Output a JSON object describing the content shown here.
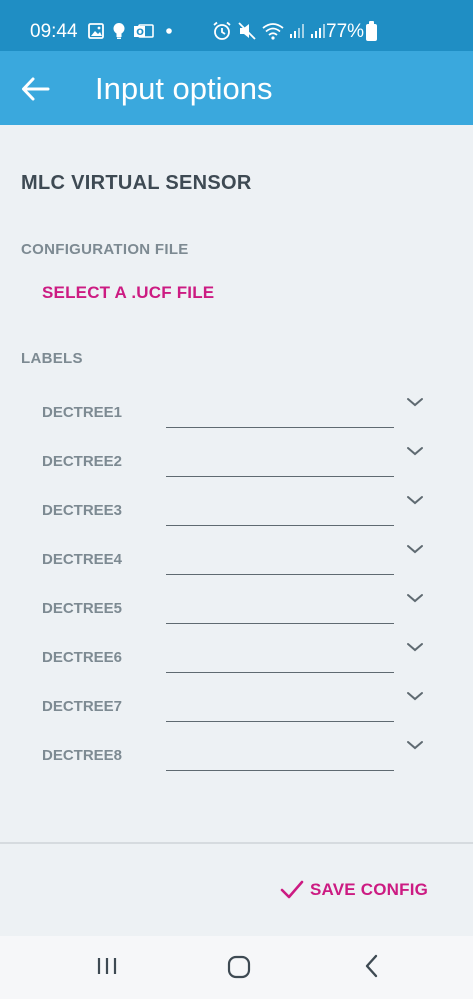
{
  "status_bar": {
    "time": "09:44",
    "battery": "77%",
    "icons": [
      "gallery-icon",
      "bulb-icon",
      "outlook-icon",
      "dot-icon",
      "alarm-icon",
      "mute-icon",
      "wifi-icon",
      "signal-icon",
      "signal-icon",
      "battery-icon"
    ]
  },
  "app_bar": {
    "back_icon": "arrow-left-icon",
    "title": "Input options"
  },
  "main": {
    "section_title": "MLC VIRTUAL SENSOR",
    "config_heading": "CONFIGURATION FILE",
    "select_file_label": "SELECT A .UCF FILE",
    "labels_heading": "LABELS",
    "labels": [
      {
        "name": "DECTREE1",
        "value": ""
      },
      {
        "name": "DECTREE2",
        "value": ""
      },
      {
        "name": "DECTREE3",
        "value": ""
      },
      {
        "name": "DECTREE4",
        "value": ""
      },
      {
        "name": "DECTREE5",
        "value": ""
      },
      {
        "name": "DECTREE6",
        "value": ""
      },
      {
        "name": "DECTREE7",
        "value": ""
      },
      {
        "name": "DECTREE8",
        "value": ""
      }
    ]
  },
  "footer": {
    "save_icon": "check-icon",
    "save_label": "SAVE CONFIG"
  },
  "nav_bar": {
    "buttons": [
      "recent-apps-icon",
      "home-icon",
      "back-icon"
    ]
  },
  "colors": {
    "status_bar": "#1f8ec4",
    "app_bar": "#3aa8dd",
    "accent": "#cc1b82",
    "background": "#edf1f4"
  }
}
